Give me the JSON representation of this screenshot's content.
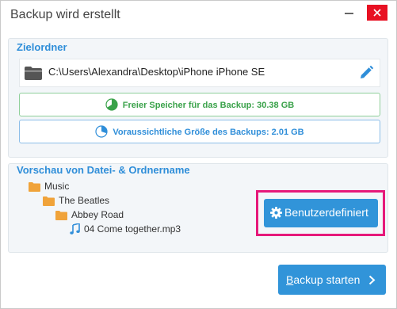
{
  "window": {
    "title": "Backup wird erstellt"
  },
  "destination": {
    "section_title": "Zielordner",
    "path": "C:\\Users\\Alexandra\\Desktop\\iPhone iPhone SE",
    "free_space_label": "Freier Speicher für das Backup: 30.38 GB",
    "estimated_size_label": "Voraussichtliche Größe des Backups: 2.01 GB"
  },
  "preview": {
    "section_title": "Vorschau von Datei- & Ordnername",
    "tree": [
      {
        "label": "Music",
        "type": "folder",
        "level": 0
      },
      {
        "label": "The Beatles",
        "type": "folder",
        "level": 1
      },
      {
        "label": "Abbey Road",
        "type": "folder",
        "level": 2
      },
      {
        "label": "04 Come together.mp3",
        "type": "music-file",
        "level": 3
      }
    ],
    "custom_button_label": "Benutzerdefiniert"
  },
  "footer": {
    "start_button_label_first": "B",
    "start_button_label_rest": "ackup starten"
  },
  "colors": {
    "accent_blue": "#3194d9",
    "green": "#3aa24a",
    "highlight_pink": "#e6197a",
    "close_red": "#e81123",
    "folder_orange": "#f0a33a"
  },
  "icons": [
    "folder-icon",
    "edit-pencil-icon",
    "pie-chart-icon",
    "music-note-icon",
    "gear-icon",
    "chevron-right-icon",
    "close-icon",
    "minimize-icon"
  ]
}
